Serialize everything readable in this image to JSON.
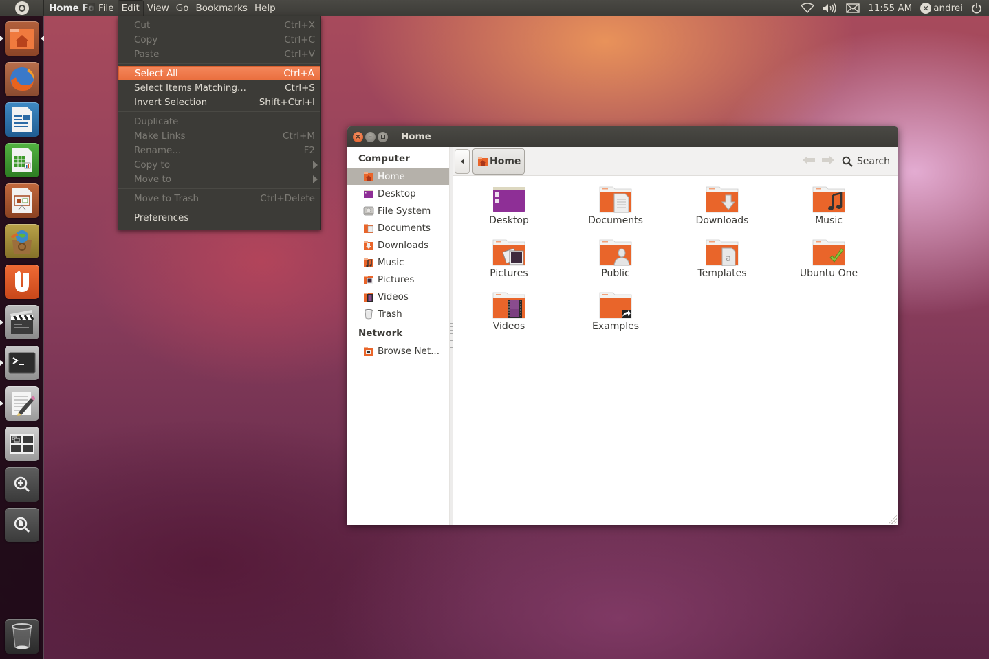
{
  "top_panel": {
    "app_title": "Home Folder",
    "menus": [
      "File",
      "Edit",
      "View",
      "Go",
      "Bookmarks",
      "Help"
    ],
    "open_menu": "Edit",
    "indicators": {
      "network": "wifi-icon",
      "sound": "volume-icon",
      "messaging": "envelope-icon",
      "clock": "11:55 AM",
      "user": "andrei",
      "session": "power-icon"
    }
  },
  "launcher": {
    "items": [
      {
        "name": "home-folder",
        "icon": "home-folder-icon",
        "running": true,
        "focused": true
      },
      {
        "name": "firefox",
        "icon": "firefox-icon"
      },
      {
        "name": "libreoffice-writer",
        "icon": "writer-icon"
      },
      {
        "name": "libreoffice-calc",
        "icon": "calc-icon"
      },
      {
        "name": "libreoffice-impress",
        "icon": "impress-icon"
      },
      {
        "name": "software-center",
        "icon": "software-center-icon"
      },
      {
        "name": "ubuntu-one",
        "icon": "ubuntu-one-icon"
      },
      {
        "name": "movie-editor",
        "icon": "clapperboard-icon",
        "running": true
      },
      {
        "name": "terminal",
        "icon": "terminal-icon",
        "running": true
      },
      {
        "name": "text-editor",
        "icon": "text-editor-icon",
        "running": true
      },
      {
        "name": "workspace-switcher",
        "icon": "workspaces-icon"
      },
      {
        "name": "applications-lens",
        "icon": "applications-lens-icon"
      },
      {
        "name": "files-lens",
        "icon": "files-lens-icon"
      },
      {
        "name": "trash",
        "icon": "trash-icon"
      }
    ]
  },
  "edit_menu": {
    "groups": [
      [
        {
          "label": "Cut",
          "accel": "Ctrl+X",
          "disabled": true
        },
        {
          "label": "Copy",
          "accel": "Ctrl+C",
          "disabled": true
        },
        {
          "label": "Paste",
          "accel": "Ctrl+V",
          "disabled": true
        }
      ],
      [
        {
          "label": "Select All",
          "accel": "Ctrl+A",
          "selected": true
        },
        {
          "label": "Select Items Matching...",
          "accel": "Ctrl+S"
        },
        {
          "label": "Invert Selection",
          "accel": "Shift+Ctrl+I"
        }
      ],
      [
        {
          "label": "Duplicate",
          "accel": "",
          "disabled": true
        },
        {
          "label": "Make Links",
          "accel": "Ctrl+M",
          "disabled": true
        },
        {
          "label": "Rename...",
          "accel": "F2",
          "disabled": true
        },
        {
          "label": "Copy to",
          "accel": "",
          "disabled": true,
          "submenu": true
        },
        {
          "label": "Move to",
          "accel": "",
          "disabled": true,
          "submenu": true
        }
      ],
      [
        {
          "label": "Move to Trash",
          "accel": "Ctrl+Delete",
          "disabled": true
        }
      ],
      [
        {
          "label": "Preferences",
          "accel": ""
        }
      ]
    ]
  },
  "window": {
    "title": "Home",
    "toolbar": {
      "breadcrumb": "Home",
      "search_label": "Search"
    },
    "sidebar": {
      "sections": [
        {
          "heading": "Computer",
          "items": [
            {
              "label": "Home",
              "icon": "home-folder-icon",
              "active": true
            },
            {
              "label": "Desktop",
              "icon": "desktop-icon"
            },
            {
              "label": "File System",
              "icon": "harddisk-icon"
            },
            {
              "label": "Documents",
              "icon": "documents-folder-icon"
            },
            {
              "label": "Downloads",
              "icon": "downloads-folder-icon"
            },
            {
              "label": "Music",
              "icon": "music-folder-icon"
            },
            {
              "label": "Pictures",
              "icon": "pictures-folder-icon"
            },
            {
              "label": "Videos",
              "icon": "videos-folder-icon"
            },
            {
              "label": "Trash",
              "icon": "trash-icon"
            }
          ]
        },
        {
          "heading": "Network",
          "items": [
            {
              "label": "Browse Net...",
              "icon": "network-folder-icon"
            }
          ]
        }
      ]
    },
    "files": [
      {
        "label": "Desktop",
        "icon": "desktop-icon"
      },
      {
        "label": "Documents",
        "icon": "documents-folder-icon"
      },
      {
        "label": "Downloads",
        "icon": "downloads-folder-icon"
      },
      {
        "label": "Music",
        "icon": "music-folder-icon"
      },
      {
        "label": "Pictures",
        "icon": "pictures-folder-icon"
      },
      {
        "label": "Public",
        "icon": "public-folder-icon"
      },
      {
        "label": "Templates",
        "icon": "templates-folder-icon"
      },
      {
        "label": "Ubuntu One",
        "icon": "ubuntu-one-folder-icon"
      },
      {
        "label": "Videos",
        "icon": "videos-folder-icon"
      },
      {
        "label": "Examples",
        "icon": "examples-link-folder-icon"
      }
    ]
  },
  "colors": {
    "accent": "#f07746",
    "panel": "#3c3b37",
    "panel_text": "#dfdbd2",
    "folder_orange": "#e95f20",
    "desktop_purple": "#7f2c88"
  }
}
